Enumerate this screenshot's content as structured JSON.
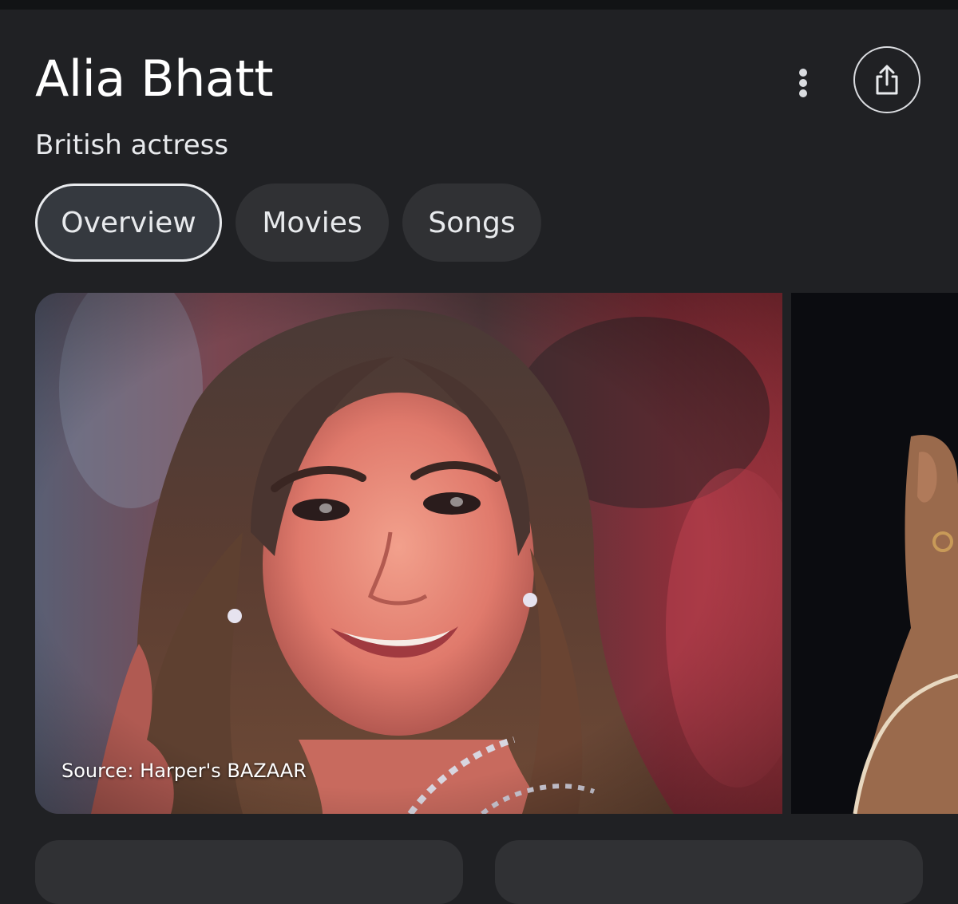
{
  "entity": {
    "name": "Alia Bhatt",
    "description": "British actress"
  },
  "actions": {
    "more_icon": "more-vert-icon",
    "share_icon": "share-icon"
  },
  "tabs": [
    {
      "label": "Overview",
      "active": true
    },
    {
      "label": "Movies",
      "active": false
    },
    {
      "label": "Songs",
      "active": false
    }
  ],
  "images": {
    "main_caption": "Source: Harper's BAZAAR"
  },
  "colors": {
    "background": "#202124",
    "chip": "#303134",
    "text": "#e8eaed"
  }
}
